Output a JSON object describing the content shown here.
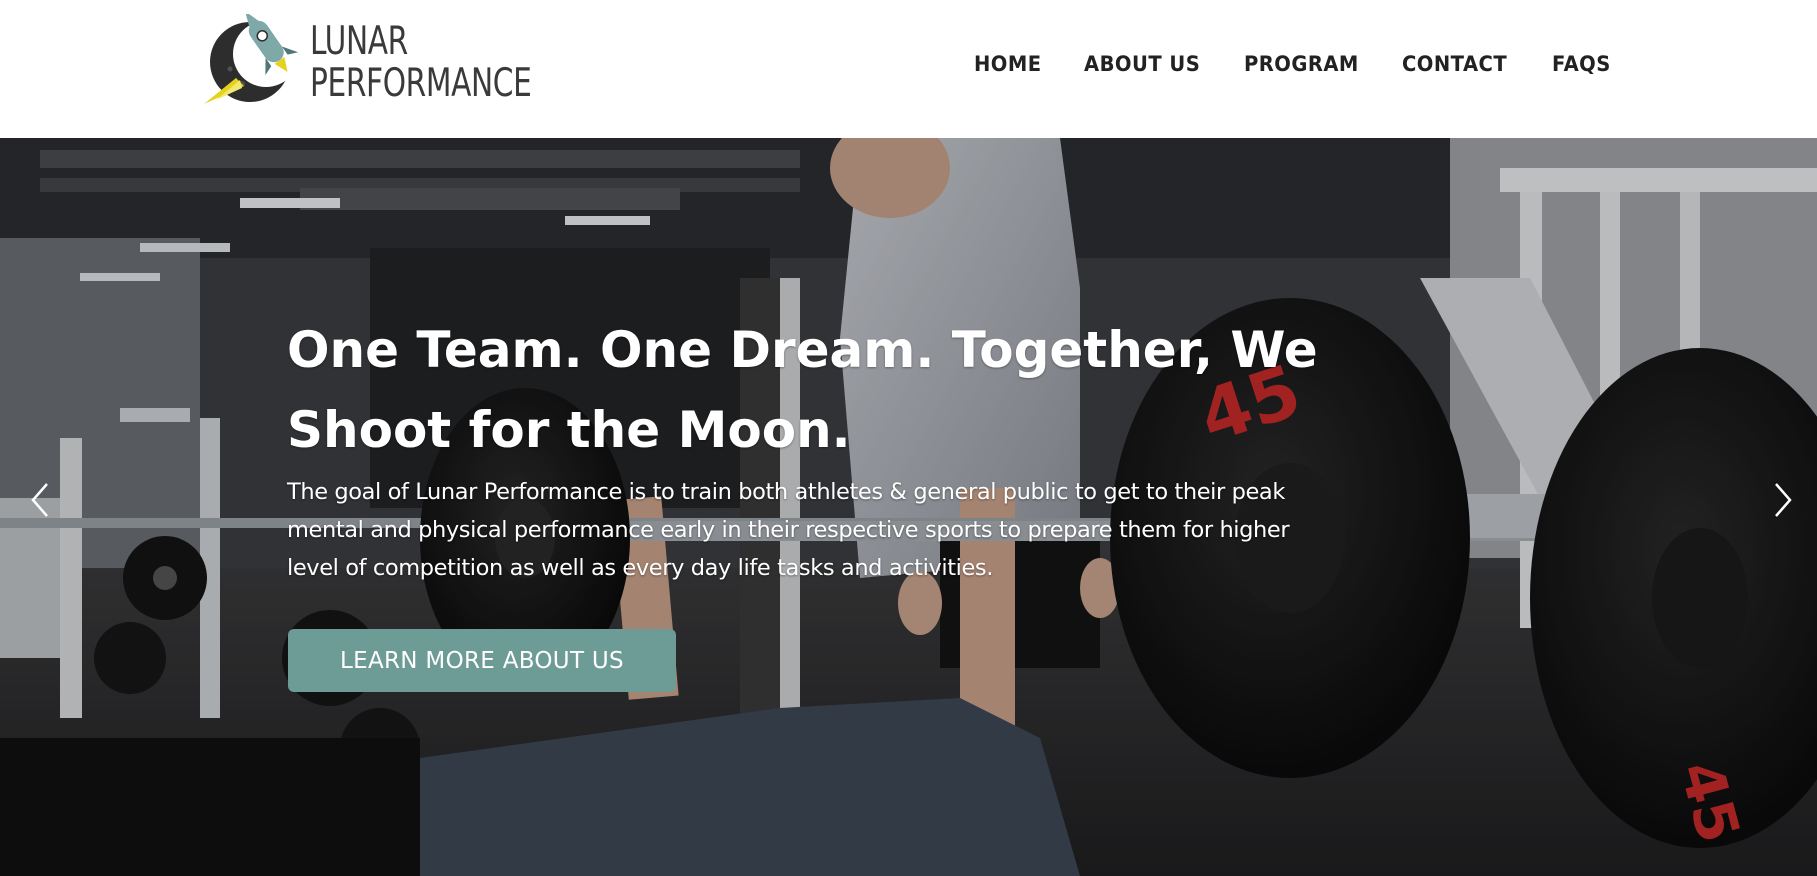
{
  "header": {
    "logo": {
      "line1": "LUNAR",
      "line2": "PERFORMANCE",
      "icon": "rocket-moon-logo-icon"
    },
    "nav": [
      {
        "label": "HOME"
      },
      {
        "label": "ABOUT US"
      },
      {
        "label": "PROGRAM"
      },
      {
        "label": "CONTACT"
      },
      {
        "label": "FAQS"
      }
    ]
  },
  "hero": {
    "headline": "One Team. One Dream. Together, We Shoot for the Moon.",
    "body": "The goal of Lunar Performance is to train both athletes & general public to get to their peak mental and physical performance early in their respective sports to prepare them for higher level of competition as well as every day life tasks and activities.",
    "cta_label": "LEARN MORE ABOUT US",
    "prev_icon": "chevron-left-icon",
    "next_icon": "chevron-right-icon",
    "photo_alt": "gym-bench-press-photo"
  },
  "colors": {
    "accent": "#6d9b96",
    "nav_text": "#222222",
    "logo_text": "#3a3a3a",
    "logo_rocket": "#7fa9a8",
    "logo_flame": "#e4d21c",
    "logo_moon": "#2d2d2d",
    "plate_lettering": "#c62a2a"
  }
}
